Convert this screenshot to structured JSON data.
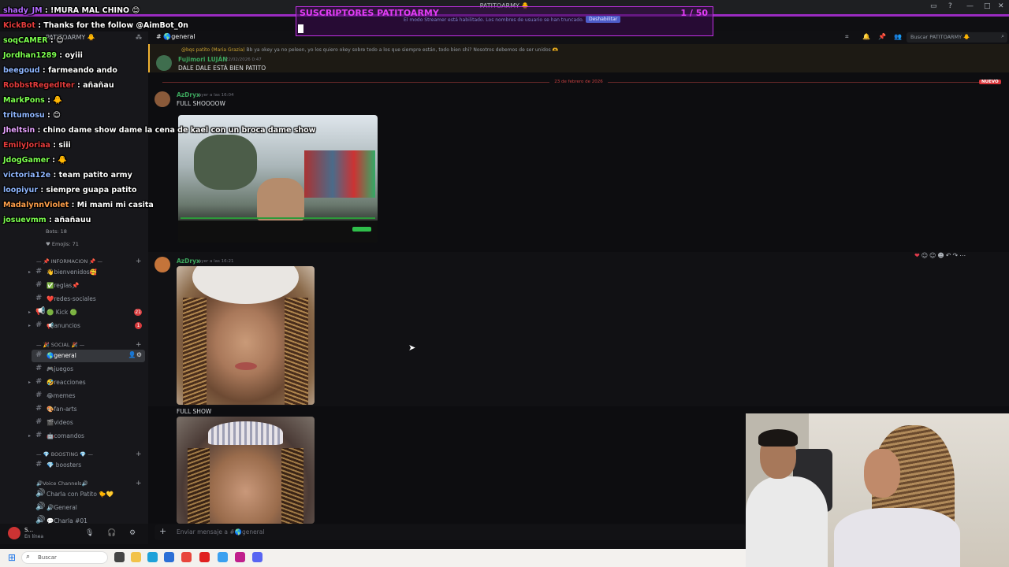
{
  "window": {
    "title": "PATITOARMY 🐥"
  },
  "overlay": {
    "subs_title": "SUSCRIPTORES PATITOARMY",
    "subs_count": "1  / 50",
    "streamer_notice": "El modo Streamer está habilitado. Los nombres de usuario se han truncado.",
    "disable_label": "Deshabilitar"
  },
  "server": {
    "name": "PATITOARMY 🐥",
    "categories": {
      "info": "— 📌 INFORMACION 📌 —",
      "social": "— 🎉 SOCIAL 🎉 —",
      "boosting": "— 💎 BOOSTING 💎 —",
      "voice": "🔊Voice Channels🔊"
    },
    "stats": [
      "Bots: 18",
      "♥ Emojis: 71"
    ],
    "channels": [
      {
        "name": "👋bienvenidos🥰",
        "badge": ""
      },
      {
        "name": "✅reglas📌",
        "badge": ""
      },
      {
        "name": "❤️redes-sociales",
        "badge": ""
      },
      {
        "name": "🟢 Kick 🟢",
        "badge": "21"
      },
      {
        "name": "📢anuncios",
        "badge": "1"
      },
      {
        "name": "🌎general",
        "badge": ""
      },
      {
        "name": "🎮juegos",
        "badge": ""
      },
      {
        "name": "🤣reacciones",
        "badge": ""
      },
      {
        "name": "😂memes",
        "badge": ""
      },
      {
        "name": "🎨fan-arts",
        "badge": ""
      },
      {
        "name": "🎬videos",
        "badge": ""
      },
      {
        "name": "🤖comandos",
        "badge": ""
      },
      {
        "name": "💎 boosters",
        "badge": ""
      },
      {
        "name": "Charla con Patito 🐤💛",
        "badge": ""
      },
      {
        "name": "🔊General",
        "badge": ""
      },
      {
        "name": "💬Charla #01",
        "badge": ""
      }
    ]
  },
  "user": {
    "name": "S...",
    "status": "En línea"
  },
  "channel": {
    "name": "🌎general",
    "search_placeholder": "Buscar PATITOARMY 🐥",
    "input_placeholder": "Enviar mensaje a #🌎general"
  },
  "messages": {
    "reply_name": "@bqs patito (Maria Grazia)",
    "reply_text": "Bb ya okey ya no peleen, yo los quiero okey sobre todo a los que siempre están, todo bien shi? Nosotros debemos de ser unidos 🫶",
    "m1_author": "Fujimori LUJÁN",
    "m1_time": "22/02/2026 0:47",
    "m1_text": "DALE DALE ESTÁ BIEN PATITO",
    "date_divider": "23 de febrero de 2026",
    "new_label": "NUEVO",
    "m2_author": "AzDryx",
    "m2_time": "ayer a las 16:04",
    "m2_text": "FULL SHOOOOW",
    "m3_author": "AzDryx",
    "m3_time": "ayer a las 16:21",
    "m3_text": "FULL SHOW"
  },
  "chat": [
    {
      "user": "shady_JM",
      "text": ": !MURA MAL CHINO 😊",
      "color": "#b36bff"
    },
    {
      "user": "KickBot",
      "text": ": Thanks for the follow @AimBot_0n",
      "color": "#e23b3b"
    },
    {
      "user": "soqCAMER",
      "text": ": 😊",
      "color": "#7cff4f"
    },
    {
      "user": "Jordhan1289",
      "text": ": oyiii",
      "color": "#7cff4f"
    },
    {
      "user": "beegoud",
      "text": ": farmeando ando",
      "color": "#8fb6ff"
    },
    {
      "user": "RobbstRegedIter",
      "text": ": añañau",
      "color": "#e23b3b"
    },
    {
      "user": "MarkPons",
      "text": ": 🐥",
      "color": "#7cff4f"
    },
    {
      "user": "tritumosu",
      "text": ": 😊",
      "color": "#8fb6ff"
    },
    {
      "user": "Jheltsin",
      "text": ": chino dame show dame la cena de kael con un broca dame show",
      "color": "#e7a3ff"
    },
    {
      "user": "EmilyJoriaa",
      "text": ": siii",
      "color": "#e23b3b"
    },
    {
      "user": "JdogGamer",
      "text": ": 🐥",
      "color": "#7cff4f"
    },
    {
      "user": "victoria12e",
      "text": ": team patito army",
      "color": "#8fb6ff"
    },
    {
      "user": "loopiyur",
      "text": ": siempre guapa patito",
      "color": "#8fb6ff"
    },
    {
      "user": "MadalynnViolet",
      "text": ": Mi mami mi casita",
      "color": "#ff9f4a"
    },
    {
      "user": "josuevmm",
      "text": ": añañauu",
      "color": "#7cff4f"
    }
  ],
  "taskbar": {
    "search_placeholder": "Buscar"
  }
}
